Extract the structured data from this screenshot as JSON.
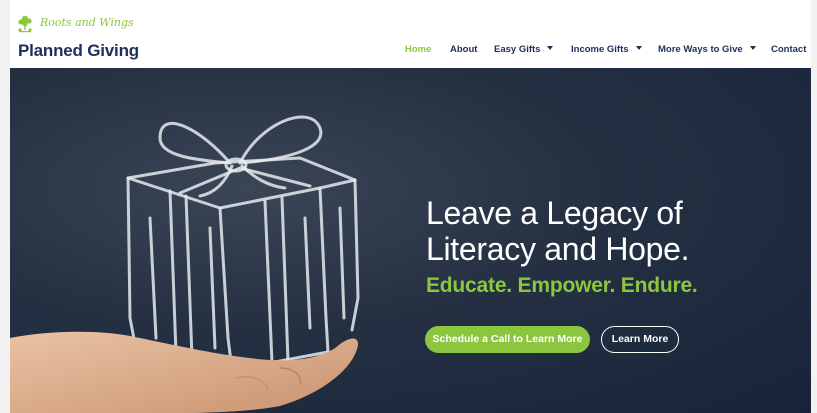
{
  "brand": {
    "script_name": "Roots and Wings",
    "title": "Planned Giving",
    "accent_color": "#8cc63f",
    "navy_color": "#1f2f5c"
  },
  "nav": {
    "home": "Home",
    "about": "About",
    "easy_gifts": "Easy Gifts",
    "income_gifts": "Income Gifts",
    "more_ways": "More Ways to Give",
    "contact": "Contact"
  },
  "hero": {
    "headline_line1": "Leave a Legacy of",
    "headline_line2": "Literacy and Hope.",
    "subhead": "Educate. Empower. Endure.",
    "primary_cta": "Schedule a Call to Learn More",
    "secondary_cta": "Learn More",
    "image_icon": "chalk-gift-box-on-hand"
  }
}
